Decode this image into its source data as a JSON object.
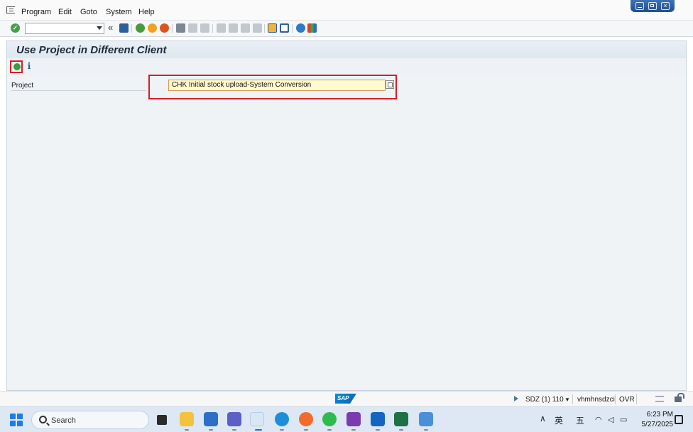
{
  "menu": {
    "items": [
      "Program",
      "Edit",
      "Goto",
      "System",
      "Help"
    ]
  },
  "toolbar": {
    "command_field_value": "",
    "collapse_label": "«"
  },
  "page": {
    "title": "Use Project in Different Client"
  },
  "form": {
    "project_label": "Project",
    "project_value": "CHK Initial stock upload-System Conversion"
  },
  "statusbar": {
    "logo_text": "SAP",
    "system": "SDZ (1) 110",
    "server": "vhmhnsdzci",
    "mode": "OVR"
  },
  "taskbar": {
    "search_placeholder": "Search",
    "ime_lang": "英",
    "ime_mode": "五",
    "time": "6:23 PM",
    "date": "5/27/2025"
  },
  "colors": {
    "highlight": "#d32027",
    "input_bg": "#fffbd0",
    "title_bg": "#e5ecf3",
    "accent": "#1f5fae"
  }
}
